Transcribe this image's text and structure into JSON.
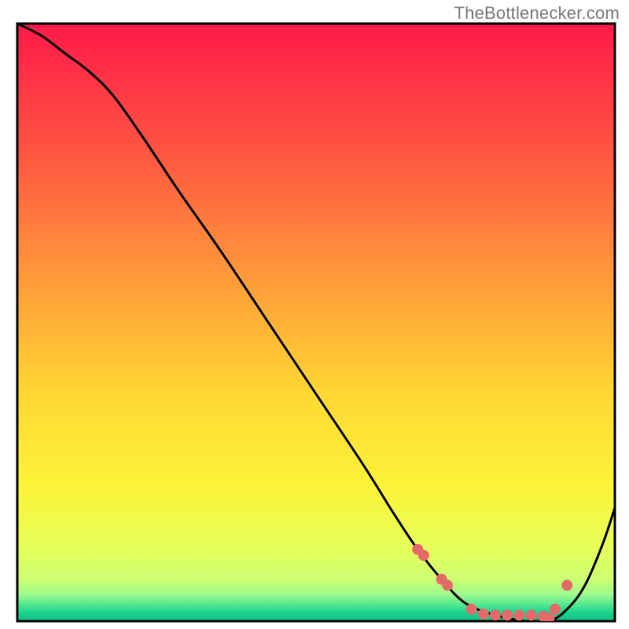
{
  "attribution": "TheBottlenecker.com",
  "chart_data": {
    "type": "line",
    "title": "",
    "xlabel": "",
    "ylabel": "",
    "xlim": [
      0,
      100
    ],
    "ylim": [
      0,
      100
    ],
    "grid": false,
    "gradient_stops": [
      {
        "offset": 0.0,
        "color": "#ff1a49"
      },
      {
        "offset": 0.2,
        "color": "#ff5142"
      },
      {
        "offset": 0.42,
        "color": "#ff983a"
      },
      {
        "offset": 0.62,
        "color": "#ffd832"
      },
      {
        "offset": 0.78,
        "color": "#fbf43a"
      },
      {
        "offset": 0.88,
        "color": "#e6ff5a"
      },
      {
        "offset": 0.93,
        "color": "#ccff73"
      },
      {
        "offset": 0.955,
        "color": "#a0fa8c"
      },
      {
        "offset": 0.972,
        "color": "#55e990"
      },
      {
        "offset": 0.985,
        "color": "#1bd38d"
      },
      {
        "offset": 1.0,
        "color": "#0fbf86"
      }
    ],
    "series": [
      {
        "name": "curve",
        "x": [
          0,
          4,
          8,
          12,
          16,
          21,
          27,
          34,
          42,
          50,
          58,
          63,
          67,
          71,
          75,
          80,
          85,
          89,
          92,
          95,
          98,
          100
        ],
        "values": [
          100,
          98,
          95,
          92,
          88,
          81,
          72,
          62,
          50,
          38,
          26,
          18,
          12,
          7,
          3,
          1,
          0,
          0,
          2,
          6,
          13,
          19
        ]
      }
    ],
    "markers": {
      "name": "dots",
      "color": "#e46a6a",
      "radius": 7,
      "x": [
        67,
        68,
        71,
        72,
        76,
        78,
        80,
        82,
        84,
        86,
        88,
        89,
        90,
        92
      ],
      "values": [
        12,
        11,
        7,
        6,
        2,
        1.2,
        1,
        1,
        1,
        1,
        0.8,
        0.5,
        2,
        6
      ]
    }
  }
}
